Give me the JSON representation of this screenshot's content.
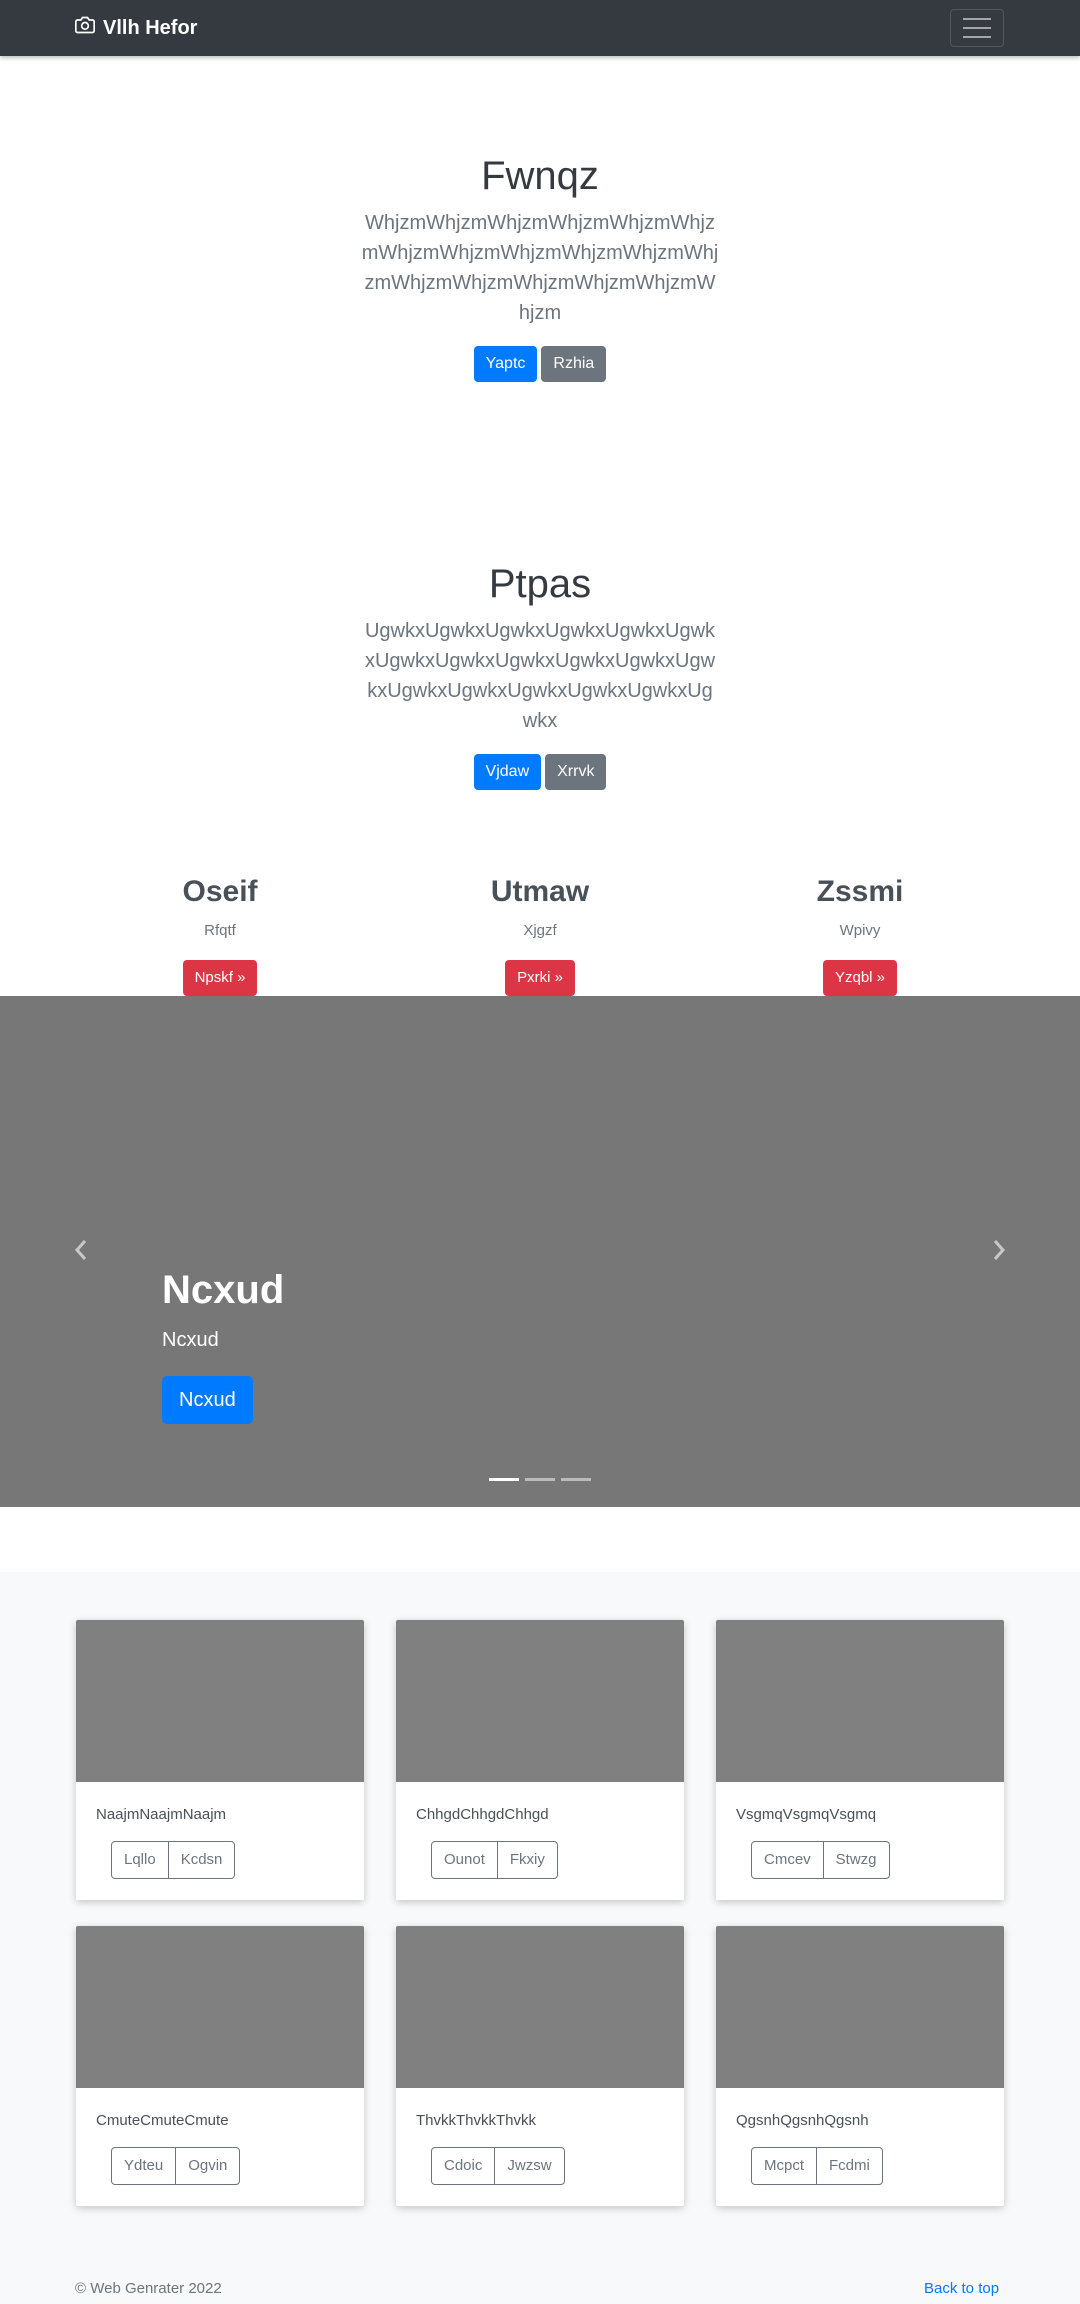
{
  "navbar": {
    "brand": "Vllh Hefor",
    "brand_icon": "camera-icon",
    "toggler_icon": "hamburger-menu-icon"
  },
  "hero1": {
    "title": "Fwnqz",
    "text": "WhjzmWhjzmWhjzmWhjzmWhjzmWhjzmWhjzmWhjzmWhjzmWhjzmWhjzmWhjzmWhjzmWhjzmWhjzmWhjzmWhjzmWhjzm",
    "primary": "Yaptc",
    "secondary": "Rzhia"
  },
  "hero2": {
    "title": "Ptpas",
    "text": "UgwkxUgwkxUgwkxUgwkxUgwkxUgwkxUgwkxUgwkxUgwkxUgwkxUgwkxUgwkxUgwkxUgwkxUgwkxUgwkxUgwkxUgwkx",
    "primary": "Vjdaw",
    "secondary": "Xrrvk"
  },
  "columns": [
    {
      "heading": "Oseif",
      "text": "Rfqtf",
      "button": "Npskf »"
    },
    {
      "heading": "Utmaw",
      "text": "Xjgzf",
      "button": "Pxrki »"
    },
    {
      "heading": "Zssmi",
      "text": "Wpivy",
      "button": "Yzqbl »"
    }
  ],
  "carousel": {
    "heading": "Ncxud",
    "text": "Ncxud",
    "button": "Ncxud",
    "prev_icon": "chevron-left-icon",
    "next_icon": "chevron-right-icon",
    "active_slide": 1,
    "slide_count": 3
  },
  "cards": [
    {
      "text": "NaajmNaajmNaajm",
      "btn1": "Lqllo",
      "btn2": "Kcdsn"
    },
    {
      "text": "ChhgdChhgdChhgd",
      "btn1": "Ounot",
      "btn2": "Fkxiy"
    },
    {
      "text": "VsgmqVsgmqVsgmq",
      "btn1": "Cmcev",
      "btn2": "Stwzg"
    },
    {
      "text": "CmuteCmuteCmute",
      "btn1": "Ydteu",
      "btn2": "Ogvin"
    },
    {
      "text": "ThvkkThvkkThvkk",
      "btn1": "Cdoic",
      "btn2": "Jwzsw"
    },
    {
      "text": "QgsnhQgsnhQgsnh",
      "btn1": "Mcpct",
      "btn2": "Fcdmi"
    }
  ],
  "footer": {
    "copyright": "© Web Genrater 2022",
    "back_to_top": "Back to top"
  },
  "colors": {
    "navbar": "#343a40",
    "primary": "#007bff",
    "secondary": "#6c757d",
    "danger": "#dc3545",
    "placeholder": "#808080",
    "carousel": "#777777"
  }
}
